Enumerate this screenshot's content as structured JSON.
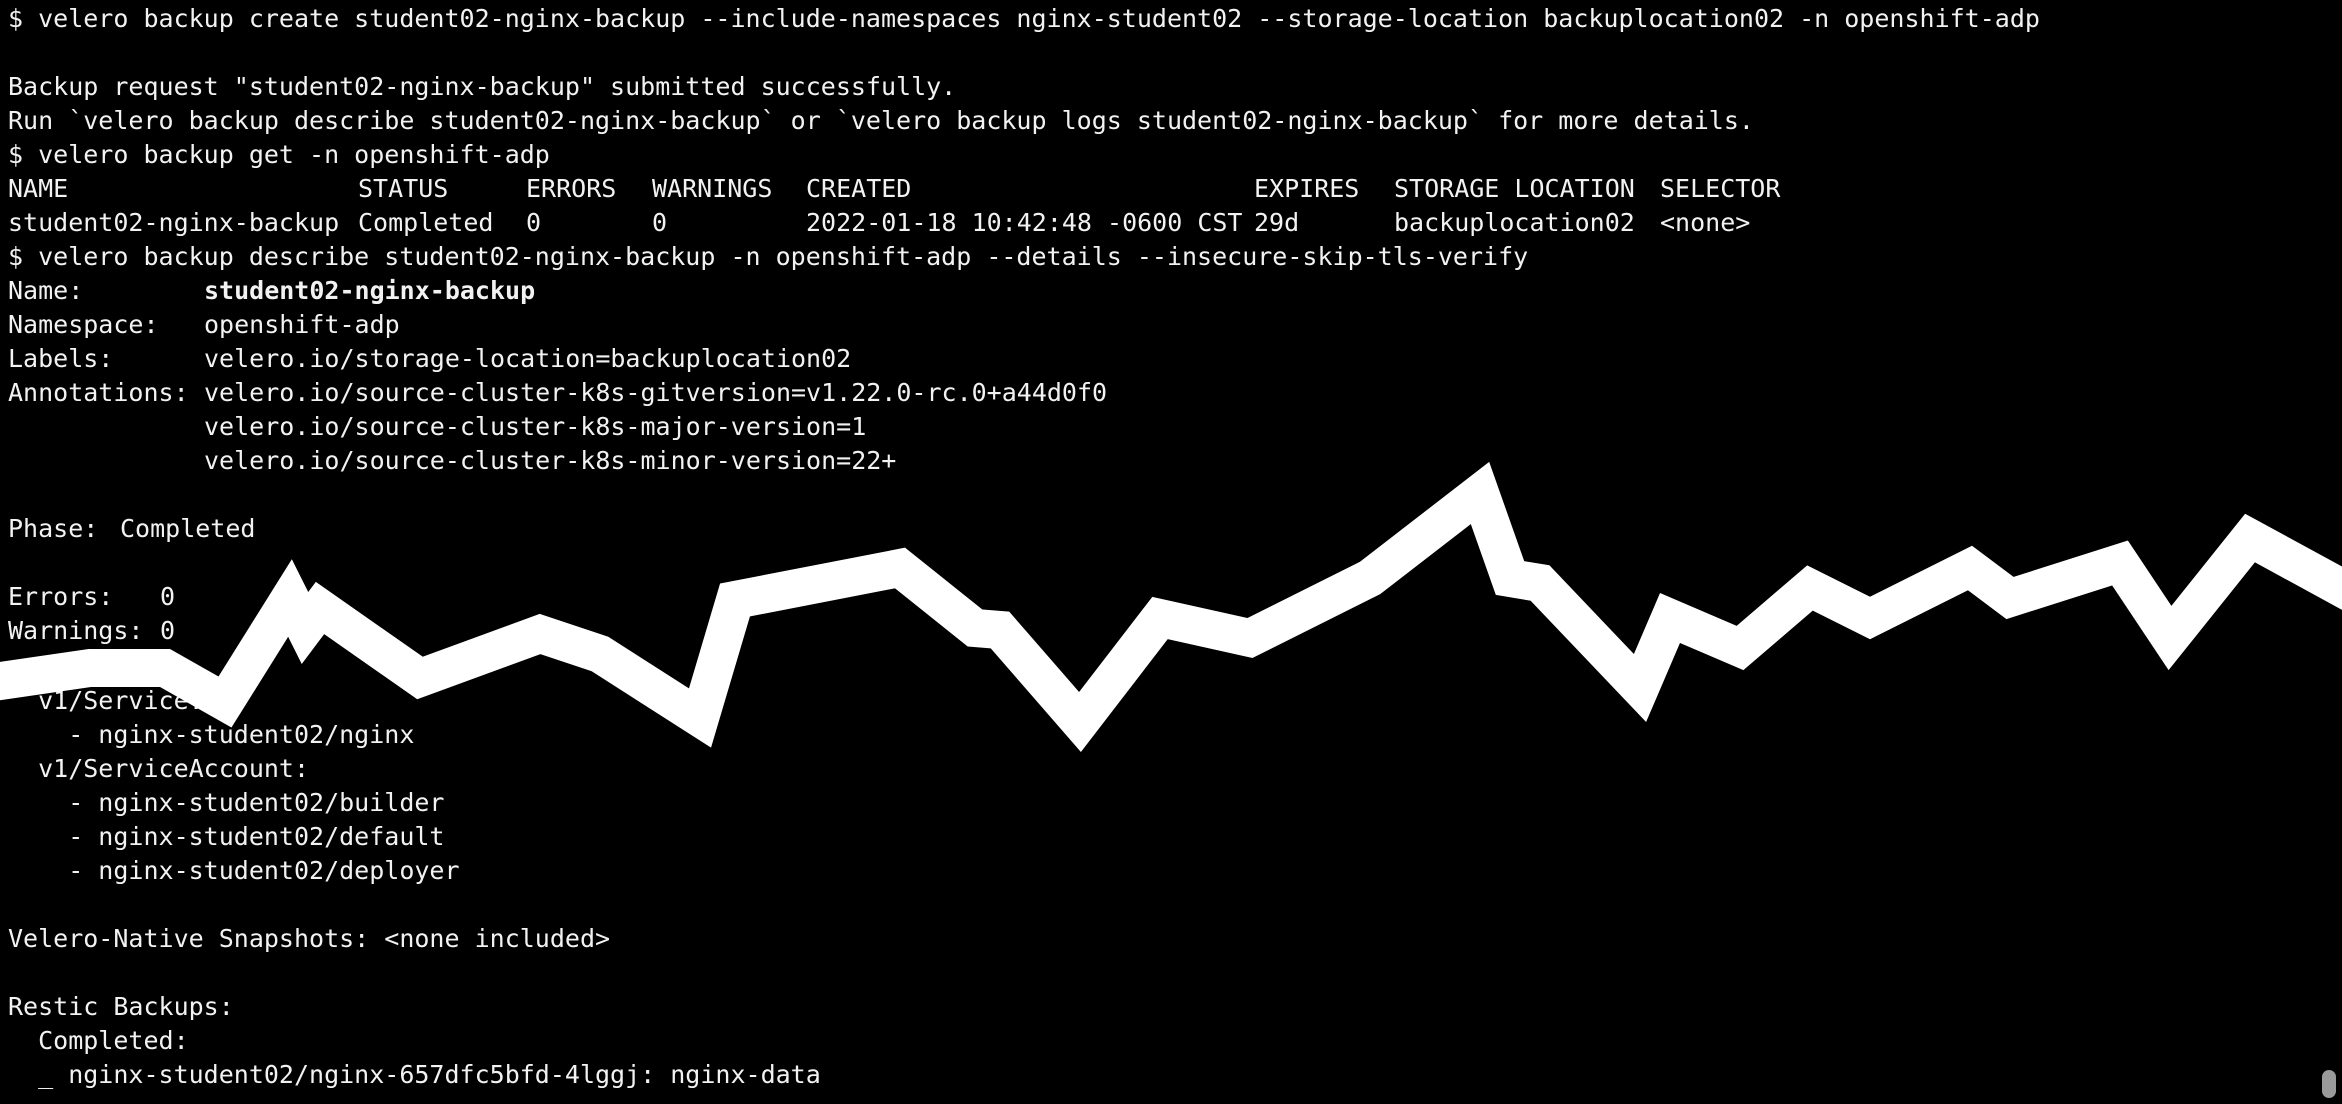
{
  "terminal": {
    "cmd_create": "$ velero backup create student02-nginx-backup --include-namespaces nginx-student02 --storage-location backuplocation02 -n openshift-adp",
    "submitted": "Backup request \"student02-nginx-backup\" submitted successfully.",
    "run_hint": "Run `velero backup describe student02-nginx-backup` or `velero backup logs student02-nginx-backup` for more details.",
    "cmd_get": "$ velero backup get -n openshift-adp",
    "table": {
      "headers": [
        "NAME",
        "STATUS",
        "ERRORS",
        "WARNINGS",
        "CREATED",
        "EXPIRES",
        "STORAGE LOCATION",
        "SELECTOR"
      ],
      "rows": [
        [
          "student02-nginx-backup",
          "Completed",
          "0",
          "0",
          "2022-01-18 10:42:48 -0600 CST",
          "29d",
          "backuplocation02",
          "<none>"
        ]
      ]
    },
    "cmd_describe": "$ velero backup describe student02-nginx-backup -n openshift-adp --details --insecure-skip-tls-verify",
    "describe": {
      "name_label": "Name:",
      "name_value": "student02-nginx-backup",
      "namespace_label": "Namespace:",
      "namespace_value": "openshift-adp",
      "labels_label": "Labels:",
      "labels_value": "velero.io/storage-location=backuplocation02",
      "annotations_label": "Annotations:",
      "annotations": [
        "velero.io/source-cluster-k8s-gitversion=v1.22.0-rc.0+a44d0f0",
        "velero.io/source-cluster-k8s-major-version=1",
        "velero.io/source-cluster-k8s-minor-version=22+"
      ],
      "phase_label": "Phase:",
      "phase_value": "Completed",
      "errors_label": "Errors:",
      "errors_value": "0",
      "warnings_label": "Warnings:",
      "warnings_value": "0",
      "service_header": "  v1/Service:",
      "service_items": [
        "    - nginx-student02/nginx"
      ],
      "serviceaccount_header": "  v1/ServiceAccount:",
      "serviceaccount_items": [
        "    - nginx-student02/builder",
        "    - nginx-student02/default",
        "    - nginx-student02/deployer"
      ],
      "snapshots": "Velero-Native Snapshots: <none included>",
      "restic_header": "Restic Backups:",
      "restic_completed": "  Completed:",
      "restic_item": "  _ nginx-student02/nginx-657dfc5bfd-4lggj: nginx-data"
    }
  },
  "colors": {
    "background": "#000000",
    "text": "#f2f2f2",
    "status_green": "#2fd12f",
    "tear_line": "#ffffff"
  }
}
